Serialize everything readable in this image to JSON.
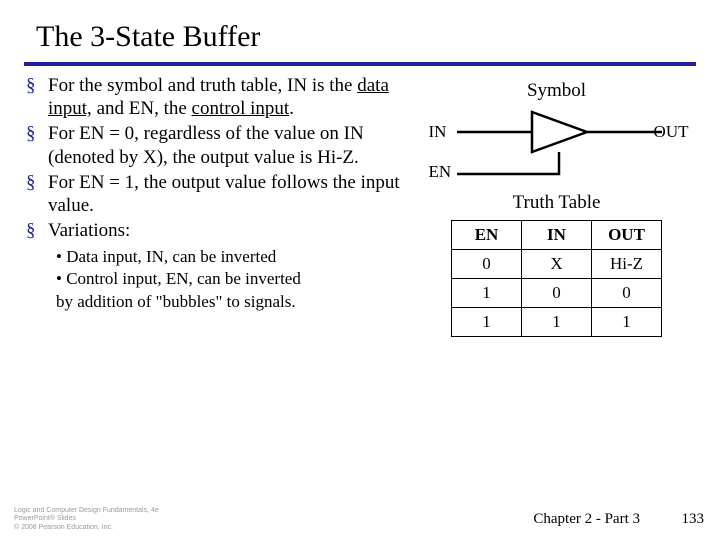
{
  "title": "The 3-State Buffer",
  "bullets": [
    {
      "pre": "For the symbol and truth table, IN is the ",
      "u1": "data input,",
      "mid": " and EN, the ",
      "u2": "control input",
      "post": "."
    },
    {
      "text": "For EN = 0, regardless of the value on IN (denoted by X), the output value is Hi-Z."
    },
    {
      "text": "For EN = 1, the output value follows the input value."
    },
    {
      "text": "Variations:"
    }
  ],
  "subs": [
    "• Data input, IN, can be inverted",
    "• Control input, EN, can be inverted",
    "by addition of \"bubbles\" to signals."
  ],
  "figure": {
    "symbol_label": "Symbol",
    "in": "IN",
    "en": "EN",
    "out": "OUT",
    "truth_label": "Truth Table"
  },
  "chart_data": {
    "type": "table",
    "title": "Truth Table",
    "columns": [
      "EN",
      "IN",
      "OUT"
    ],
    "rows": [
      [
        "0",
        "X",
        "Hi-Z"
      ],
      [
        "1",
        "0",
        "0"
      ],
      [
        "1",
        "1",
        "1"
      ]
    ]
  },
  "footer": {
    "copyright": [
      "Logic and Computer Design Fundamentals, 4e",
      "PowerPoint® Slides",
      "© 2008 Pearson Education, Inc."
    ],
    "chapter": "Chapter 2 - Part 3",
    "page": "133"
  }
}
